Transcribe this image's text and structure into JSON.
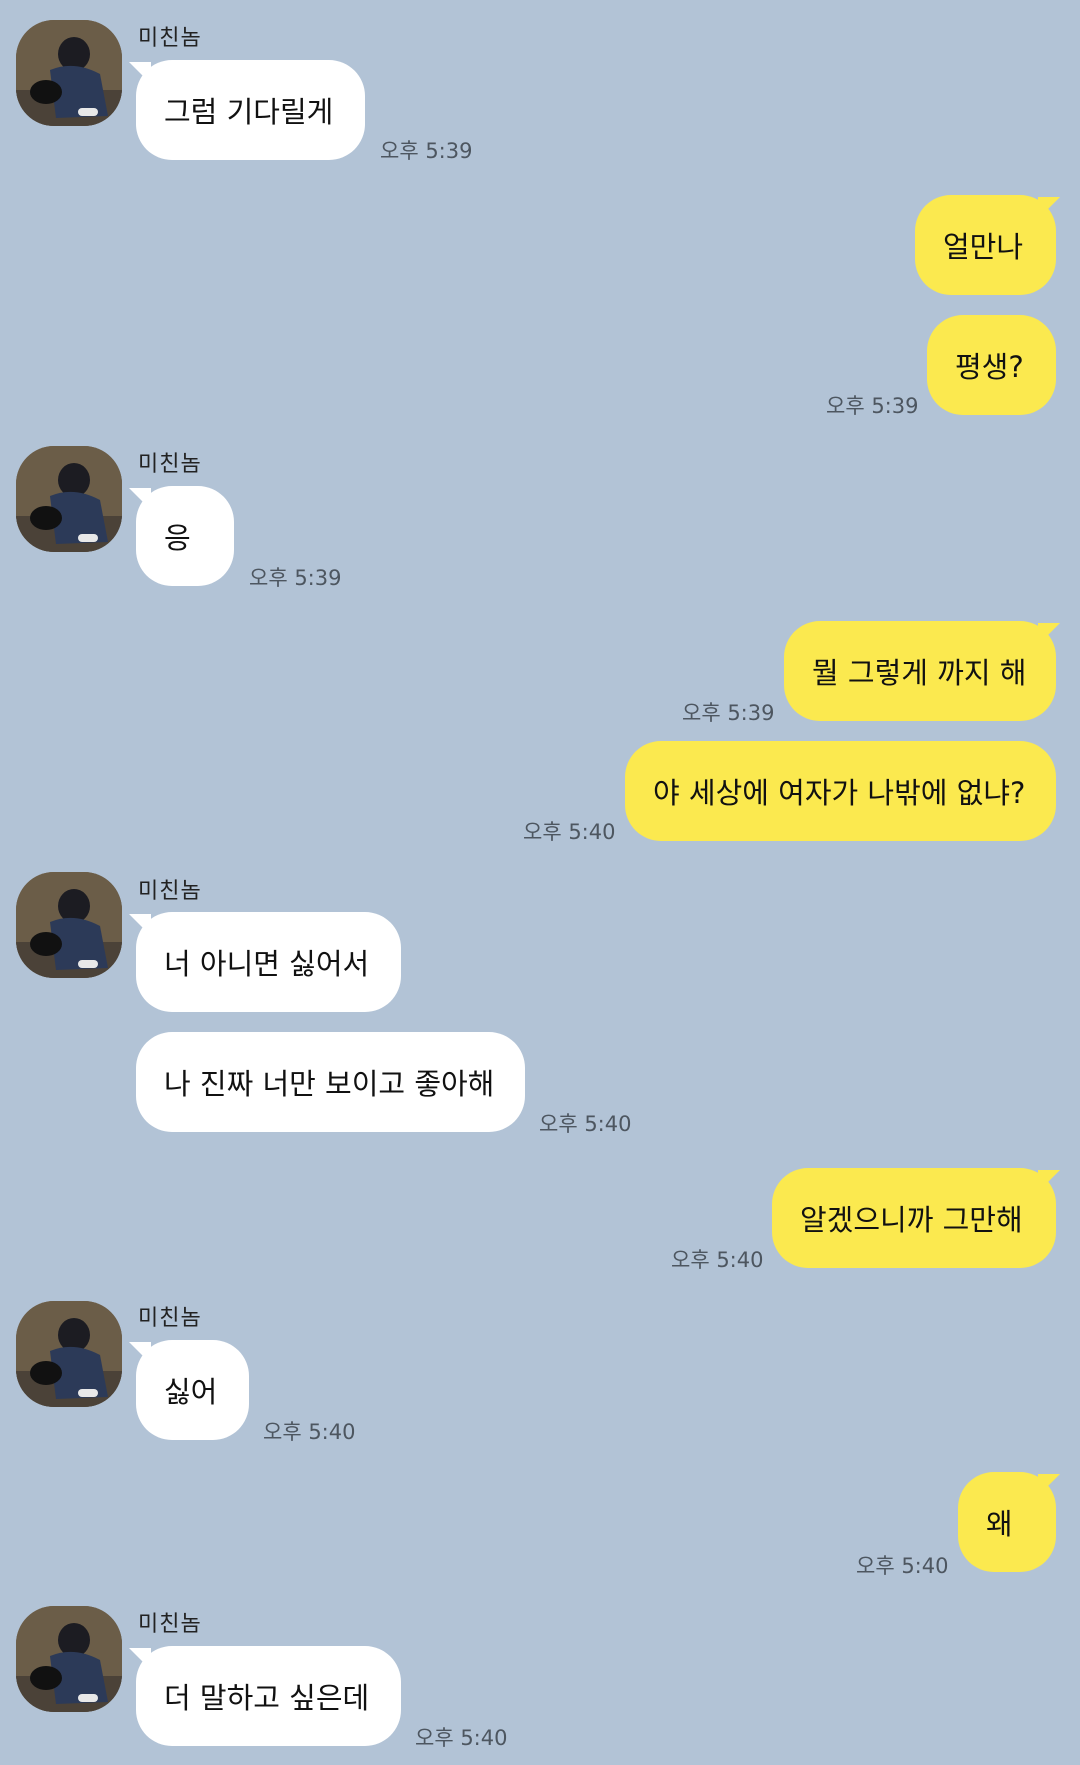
{
  "contact": {
    "name": "미친놈",
    "avatar_icon": "profile-photo"
  },
  "messages": [
    {
      "id": "m1",
      "sender": "contact",
      "text": "그럼 기다릴게",
      "time": "오후 5:39"
    },
    {
      "id": "m2",
      "sender": "me",
      "text": "얼만나",
      "time": ""
    },
    {
      "id": "m3",
      "sender": "me",
      "text": "평생?",
      "time": "오후 5:39"
    },
    {
      "id": "m4",
      "sender": "contact",
      "text": "응",
      "time": "오후 5:39"
    },
    {
      "id": "m5",
      "sender": "me",
      "text": "뭘 그렇게 까지 해",
      "time": "오후 5:39"
    },
    {
      "id": "m6",
      "sender": "me",
      "text": "야 세상에 여자가 나밖에 없냐?",
      "time": "오후 5:40"
    },
    {
      "id": "m7",
      "sender": "contact",
      "text": "너 아니면 싫어서",
      "time": ""
    },
    {
      "id": "m8",
      "sender": "contact",
      "text": "나 진짜 너만 보이고 좋아해",
      "time": "오후 5:40"
    },
    {
      "id": "m9",
      "sender": "me",
      "text": "알겠으니까 그만해",
      "time": "오후 5:40"
    },
    {
      "id": "m10",
      "sender": "contact",
      "text": "싫어",
      "time": "오후 5:40"
    },
    {
      "id": "m11",
      "sender": "me",
      "text": "왜",
      "time": "오후 5:40"
    },
    {
      "id": "m12",
      "sender": "contact",
      "text": "더 말하고 싶은데",
      "time": "오후 5:40"
    }
  ],
  "colors": {
    "background": "#b2c3d6",
    "incoming_bubble": "#ffffff",
    "outgoing_bubble": "#fbe94f"
  }
}
